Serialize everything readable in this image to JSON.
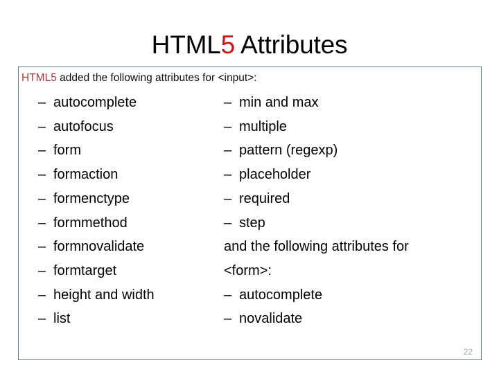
{
  "slide": {
    "title_prefix": "HTML",
    "title_highlight": "5",
    "title_suffix": " Attributes",
    "page_number": "22",
    "frame_border_color": "#5e808e",
    "title_highlight_color": "#cc1111",
    "lead_highlight_color": "#a63a3a",
    "page_number_color": "#97a9b1"
  },
  "content": {
    "lead_in": {
      "highlight": "HTML5",
      "rest": " added the following attributes for <input>:"
    },
    "bullet_mark": "–",
    "left_column": [
      {
        "label": "autocomplete"
      },
      {
        "label": "autofocus"
      },
      {
        "label": "form"
      },
      {
        "label": "formaction"
      },
      {
        "label": "formenctype"
      },
      {
        "label": "formmethod"
      },
      {
        "label": "formnovalidate"
      },
      {
        "label": "formtarget"
      },
      {
        "label": "height and width"
      },
      {
        "label": "list"
      }
    ],
    "right_column": [
      {
        "label": "min and max"
      },
      {
        "label": "multiple"
      },
      {
        "label": "pattern (regexp)"
      },
      {
        "label": "placeholder"
      },
      {
        "label": "required"
      },
      {
        "label": "step"
      }
    ],
    "right_paragraph": "and the following attributes for <form>:",
    "right_column_2": [
      {
        "label": "autocomplete"
      },
      {
        "label": "novalidate"
      }
    ]
  }
}
